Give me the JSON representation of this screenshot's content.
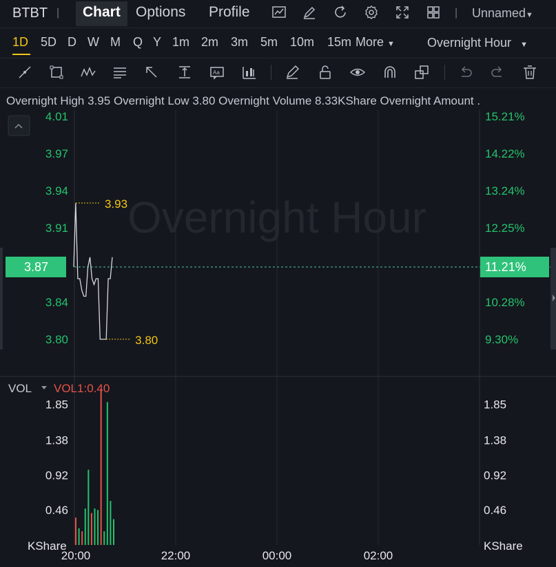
{
  "header": {
    "symbol": "BTBT",
    "tabs": [
      "Chart",
      "Options",
      "Profile"
    ],
    "active_tab": "Chart",
    "layout_name": "Unnamed",
    "icons": [
      "chart-settings-icon",
      "draw-icon",
      "refresh-icon",
      "gear-icon",
      "fullscreen-icon",
      "layout-grid-icon"
    ]
  },
  "timeframes": {
    "items": [
      "1D",
      "5D",
      "D",
      "W",
      "M",
      "Q",
      "Y",
      "1m",
      "2m",
      "3m",
      "5m",
      "10m",
      "15m"
    ],
    "active": "1D",
    "more_label": "More",
    "session_label": "Overnight Hour"
  },
  "tools": [
    "trend-line-icon",
    "rectangle-icon",
    "pattern-icon",
    "fib-icon",
    "arrow-icon",
    "measure-icon",
    "text-note-icon",
    "indicator-icon",
    "pencil-icon",
    "unlock-icon",
    "eye-icon",
    "magnet-icon",
    "clone-icon",
    "undo-icon",
    "redo-icon",
    "trash-icon"
  ],
  "stats": {
    "high_label": "Overnight High",
    "high_value": "3.95",
    "low_label": "Overnight Low",
    "low_value": "3.80",
    "volume_label": "Overnight Volume",
    "volume_value": "8.33KShare",
    "amount_label": "Overnight Amount ."
  },
  "chart_data": [
    {
      "type": "line",
      "watermark": "Overnight Hour",
      "y_ticks_left": [
        "4.01",
        "3.97",
        "3.94",
        "3.91",
        "3.87",
        "3.84",
        "3.80"
      ],
      "y_ticks_right": [
        "15.21%",
        "14.22%",
        "13.24%",
        "12.25%",
        "11.21%",
        "10.28%",
        "9.30%"
      ],
      "ylim": [
        3.78,
        4.01
      ],
      "current_price": "3.87",
      "current_pct": "11.21%",
      "high_marker": "3.93",
      "low_marker": "3.80",
      "x_ticks": [
        "20:00",
        "22:00",
        "00:00",
        "02:00"
      ],
      "series": [
        {
          "values": [
            3.87,
            3.93,
            3.86,
            3.86,
            3.85,
            3.845,
            3.845,
            3.87,
            3.88,
            3.86,
            3.855,
            3.86,
            3.86,
            3.8,
            3.8,
            3.8,
            3.8,
            3.86,
            3.86,
            3.88
          ]
        }
      ]
    },
    {
      "type": "bar",
      "indicator_label": "VOL",
      "vol_label": "VOL1:0.40",
      "unit": "KShare",
      "y_ticks": [
        "1.85",
        "1.38",
        "0.92",
        "0.46"
      ],
      "ylim": [
        0,
        2.1
      ],
      "values": [
        0.36,
        0.22,
        0.18,
        0.48,
        0.99,
        0.42,
        0.48,
        0.46,
        2.05,
        0.18,
        1.88,
        0.58,
        0.34
      ],
      "colors": [
        "down",
        "up",
        "down",
        "up",
        "up",
        "down",
        "up",
        "up",
        "down",
        "up",
        "up",
        "up",
        "up"
      ]
    }
  ],
  "colors": {
    "up": "#25c26e",
    "down": "#e8534a",
    "accent": "#f5c518",
    "price_tag": "#2fc27a",
    "line": "#d6d8dc",
    "grid": "#262a31"
  }
}
